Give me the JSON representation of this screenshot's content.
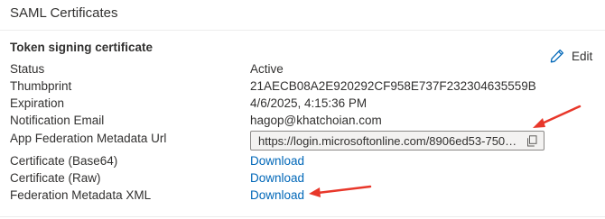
{
  "panel": {
    "title": "SAML Certificates"
  },
  "token_signing": {
    "heading": "Token signing certificate",
    "edit_label": "Edit",
    "fields": {
      "status": {
        "label": "Status",
        "value": "Active"
      },
      "thumbprint": {
        "label": "Thumbprint",
        "value": "21AECB08A2E920292CF958E737F232304635559B"
      },
      "expiration": {
        "label": "Expiration",
        "value": "4/6/2025, 4:15:36 PM"
      },
      "email": {
        "label": "Notification Email",
        "value": "hagop@khatchoian.com"
      },
      "metadata_url": {
        "label": "App Federation Metadata Url",
        "value": "https://login.microsoftonline.com/8906ed53-750c..."
      },
      "cert_base64": {
        "label": "Certificate (Base64)",
        "value": "Download"
      },
      "cert_raw": {
        "label": "Certificate (Raw)",
        "value": "Download"
      },
      "fed_xml": {
        "label": "Federation Metadata XML",
        "value": "Download"
      }
    }
  },
  "annotation_color": "#e8372a",
  "icons": {
    "edit": "pencil-icon",
    "copy": "copy-icon"
  }
}
